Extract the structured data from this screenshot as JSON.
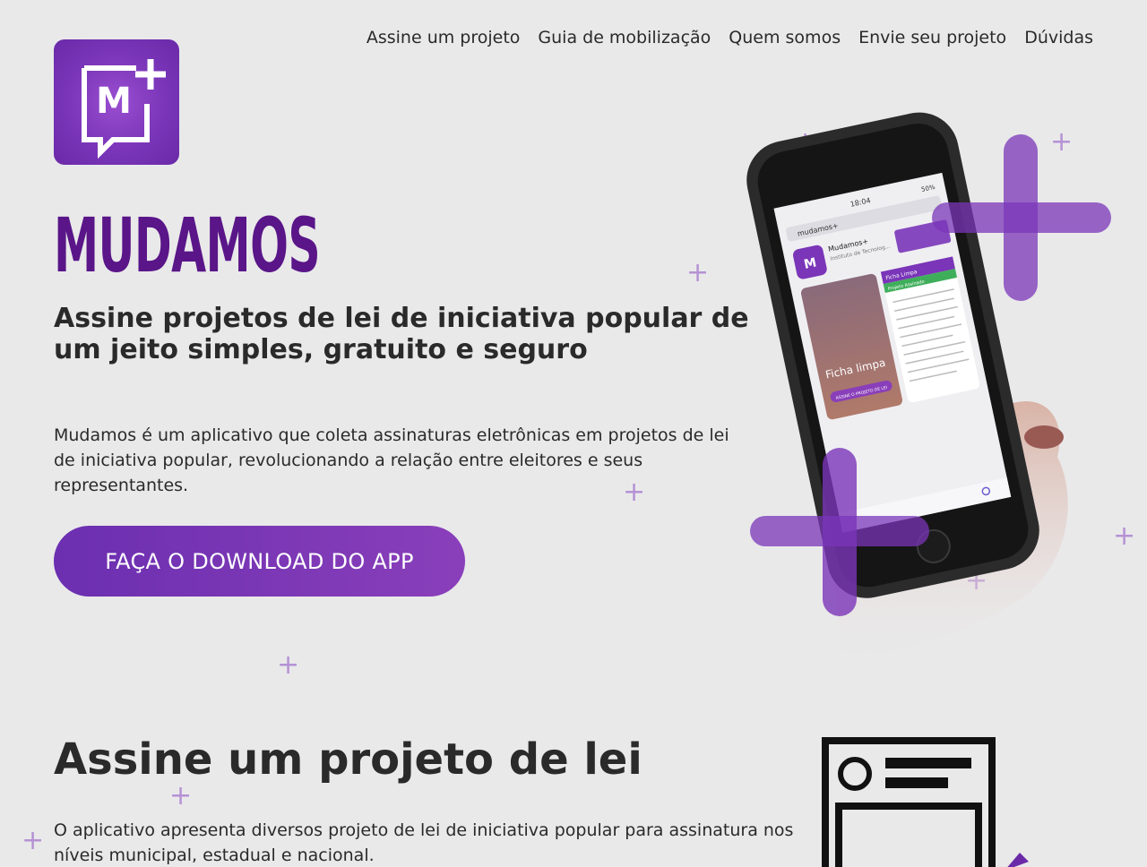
{
  "header": {
    "logo_text": "M",
    "nav": [
      {
        "label": "Assine um projeto"
      },
      {
        "label": "Guia de mobilização"
      },
      {
        "label": "Quem somos"
      },
      {
        "label": "Envie seu projeto"
      },
      {
        "label": "Dúvidas"
      }
    ]
  },
  "hero": {
    "brand": "MUDAMOS",
    "tagline": "Assine projetos de lei de iniciativa popular de um jeito simples, gratuito e seguro",
    "description": "Mudamos é um aplicativo que coleta assinaturas eletrônicas em projetos de lei de iniciativa popular, revolucionando a relação entre eleitores e seus representantes.",
    "cta_label": "FAÇA O DOWNLOAD DO APP"
  },
  "phone_screen": {
    "time": "18:04",
    "battery": "50%",
    "search_text": "mudamos+",
    "app_name": "Mudamos+",
    "app_developer": "Instituto de Tecnolog...",
    "card_title": "Ficha limpa",
    "card_button": "ASSINE O PROJETO DE LEI",
    "right_card_title": "Ficha Limpa",
    "right_card_badge": "Projeto Assinado"
  },
  "section": {
    "title": "Assine um projeto de lei",
    "description": "O aplicativo apresenta diversos projeto de lei de iniciativa popular para assinatura nos níveis municipal, estadual e nacional."
  },
  "colors": {
    "brand_purple": "#5a1588",
    "accent_purple": "#7a35b8",
    "background": "#e9e9ea",
    "decor_plus": "#b592d4"
  },
  "icons": {
    "logo": "speech-bubble-m-plus-icon",
    "decor": "plus-icon",
    "section": "document-icon"
  }
}
